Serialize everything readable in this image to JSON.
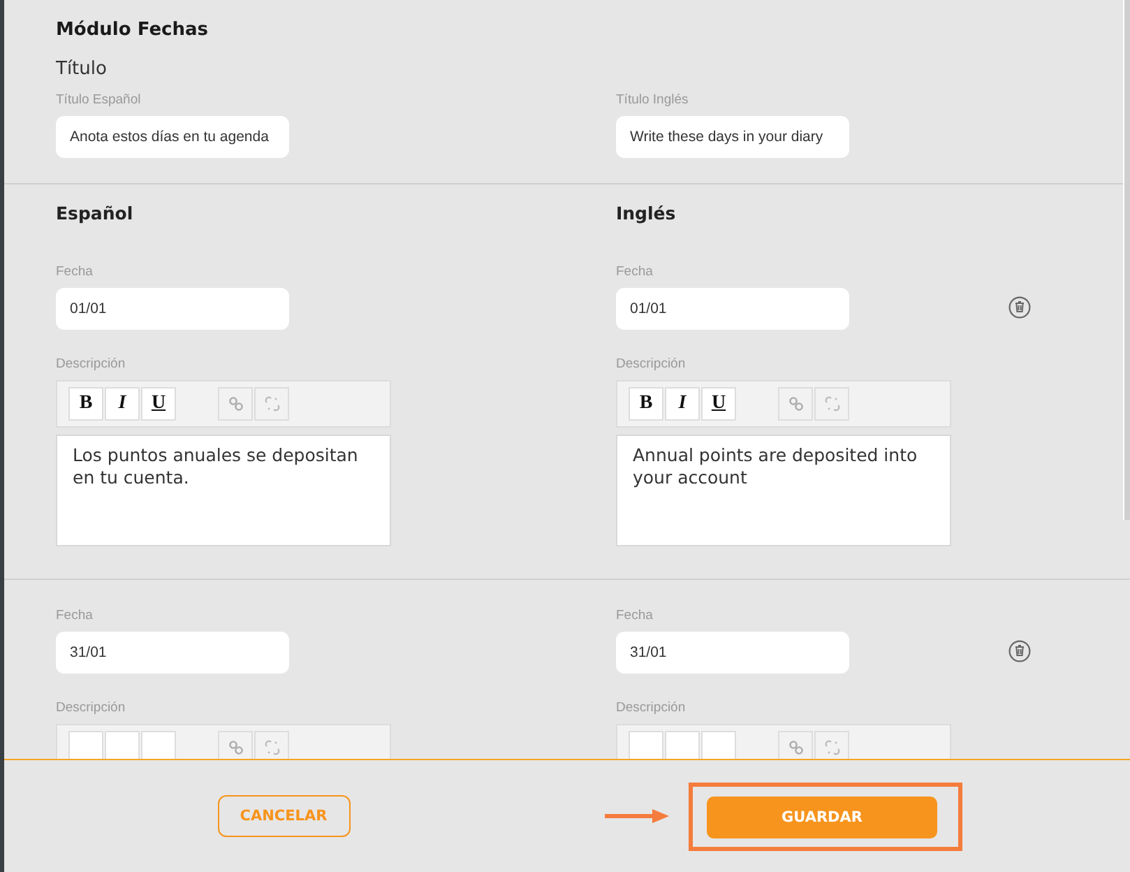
{
  "module": {
    "title": "Módulo Fechas",
    "section": "Título",
    "fields": [
      {
        "label": "Título Español",
        "value": "Anota estos días en tu agenda"
      },
      {
        "label": "Título Inglés",
        "value": "Write these days in your diary"
      }
    ]
  },
  "columns": [
    "Español",
    "Inglés"
  ],
  "entries": [
    {
      "langs": [
        {
          "date_label": "Fecha",
          "date": "01/01",
          "desc_label": "Descripción",
          "toolbar": [
            "B",
            "I",
            "U"
          ],
          "description": "Los puntos anuales se depositan en tu cuenta."
        },
        {
          "date_label": "Fecha",
          "date": "01/01",
          "desc_label": "Descripción",
          "toolbar": [
            "B",
            "I",
            "U"
          ],
          "description": "Annual points are deposited into your account"
        }
      ]
    },
    {
      "langs": [
        {
          "date_label": "Fecha",
          "date": "31/01",
          "desc_label": "Descripción"
        },
        {
          "date_label": "Fecha",
          "date": "31/01",
          "desc_label": "Descripción"
        }
      ]
    }
  ],
  "footer": {
    "cancel": "CANCELAR",
    "save": "GUARDAR"
  }
}
